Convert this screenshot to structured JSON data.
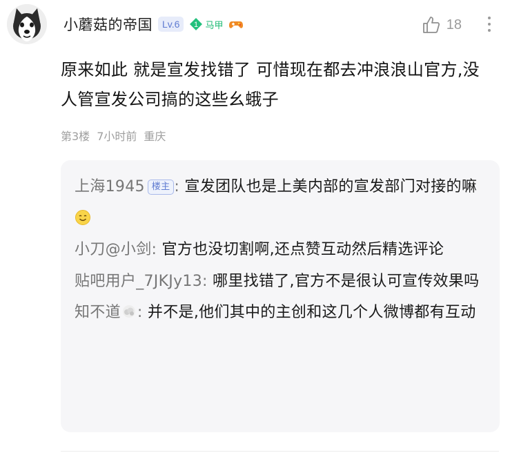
{
  "comment": {
    "author": {
      "name": "小蘑菇的帝国",
      "level": "Lv.6",
      "vest_number": "1",
      "vest_label": "马甲",
      "avatar_icon": "husky-dog-avatar",
      "game_badge_icon": "gamepad-icon"
    },
    "like_count": "18",
    "text": "原来如此 就是宣发找错了 可惜现在都去冲浪浪山官方,没人管宣发公司搞的这些幺蛾子",
    "meta": {
      "floor": "第3楼",
      "time": "7小时前",
      "location": "重庆"
    },
    "replies": [
      {
        "author": "上海1945",
        "tag": "楼主",
        "separator": ":",
        "text": "  宣发团队也是上美内部的宣发部门对接的嘛",
        "emoji": "smile-emoji-icon"
      },
      {
        "author": "小刀@小剑",
        "separator": ":",
        "text": "  官方也没切割啊,还点赞互动然后精选评论"
      },
      {
        "author": "贴吧用户_7JKJy13",
        "separator": ":",
        "text": "  哪里找错了,官方不是很认可宣传效果吗"
      },
      {
        "author": "知不道",
        "separator": ":",
        "text": "  并不是,他们其中的主创和这几个人微博都有互动",
        "author_icon": "cloud-badge-icon"
      }
    ]
  },
  "colors": {
    "accent_blue": "#5f7bd1",
    "vest_green": "#1dba74",
    "muted_text": "#9e9e9e",
    "reply_bg": "#f6f6f8"
  }
}
